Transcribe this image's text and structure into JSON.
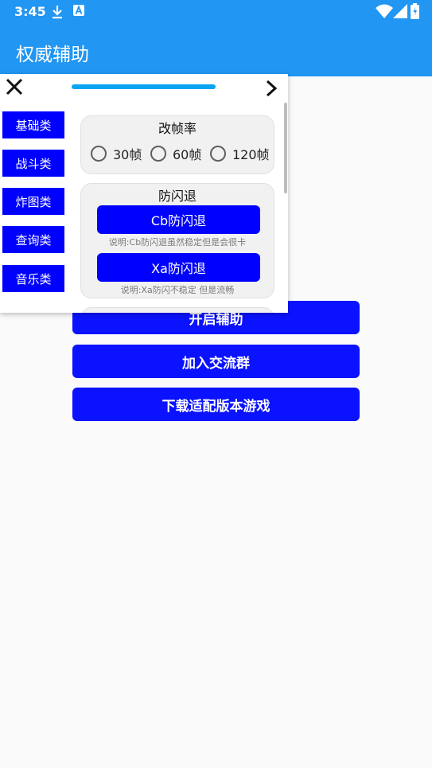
{
  "status_bar": {
    "time": "3:45",
    "icons": [
      "download-icon",
      "a-badge-icon",
      "wifi-icon",
      "signal-icon",
      "battery-icon"
    ]
  },
  "app_bar": {
    "title": "权威辅助"
  },
  "main_buttons": [
    {
      "label": "开启辅助"
    },
    {
      "label": "加入交流群"
    },
    {
      "label": "下载适配版本游戏"
    }
  ],
  "overlay": {
    "categories": [
      "基础类",
      "战斗类",
      "炸图类",
      "查询类",
      "音乐类"
    ],
    "frame_rate": {
      "title": "改帧率",
      "options": [
        "30帧",
        "60帧",
        "120帧"
      ]
    },
    "anti_flash": {
      "title": "防闪退",
      "cb_button": "Cb防闪退",
      "cb_note": "说明:Cb防闪退虽然稳定但是会很卡",
      "xa_button": "Xa防闪退",
      "xa_note": "说明:Xa防闪不稳定 但是流畅"
    }
  },
  "colors": {
    "primary": "#2196f3",
    "button_blue": "#0a12ff",
    "category_blue": "#0000ff",
    "progress": "#0aa5f0"
  }
}
